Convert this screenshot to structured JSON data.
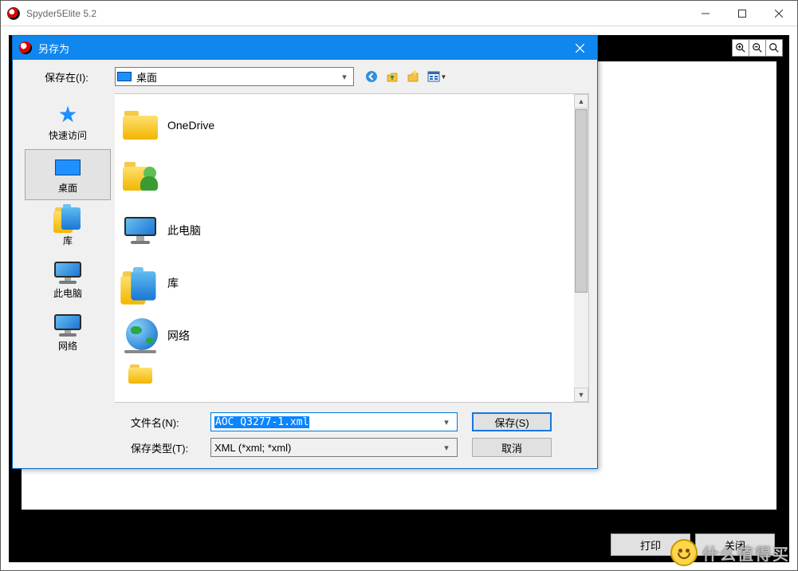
{
  "main_window": {
    "title": "Spyder5Elite 5.2",
    "footer_print": "打印",
    "footer_close": "关闭"
  },
  "watermark_text": "什么值得买",
  "dialog": {
    "title": "另存为",
    "lookin_label": "保存在(I):",
    "lookin_value": "桌面",
    "places": {
      "quick": "快速访问",
      "desktop": "桌面",
      "library": "库",
      "thispc": "此电脑",
      "network": "网络"
    },
    "items": {
      "onedrive": "OneDrive",
      "user": "",
      "thispc": "此电脑",
      "library": "库",
      "network": "网络"
    },
    "filename_label": "文件名(N):",
    "filename_value": "AOC Q3277-1.xml",
    "filetype_label": "保存类型(T):",
    "filetype_value": "XML (*xml; *xml)",
    "save_btn": "保存(S)",
    "cancel_btn": "取消"
  }
}
